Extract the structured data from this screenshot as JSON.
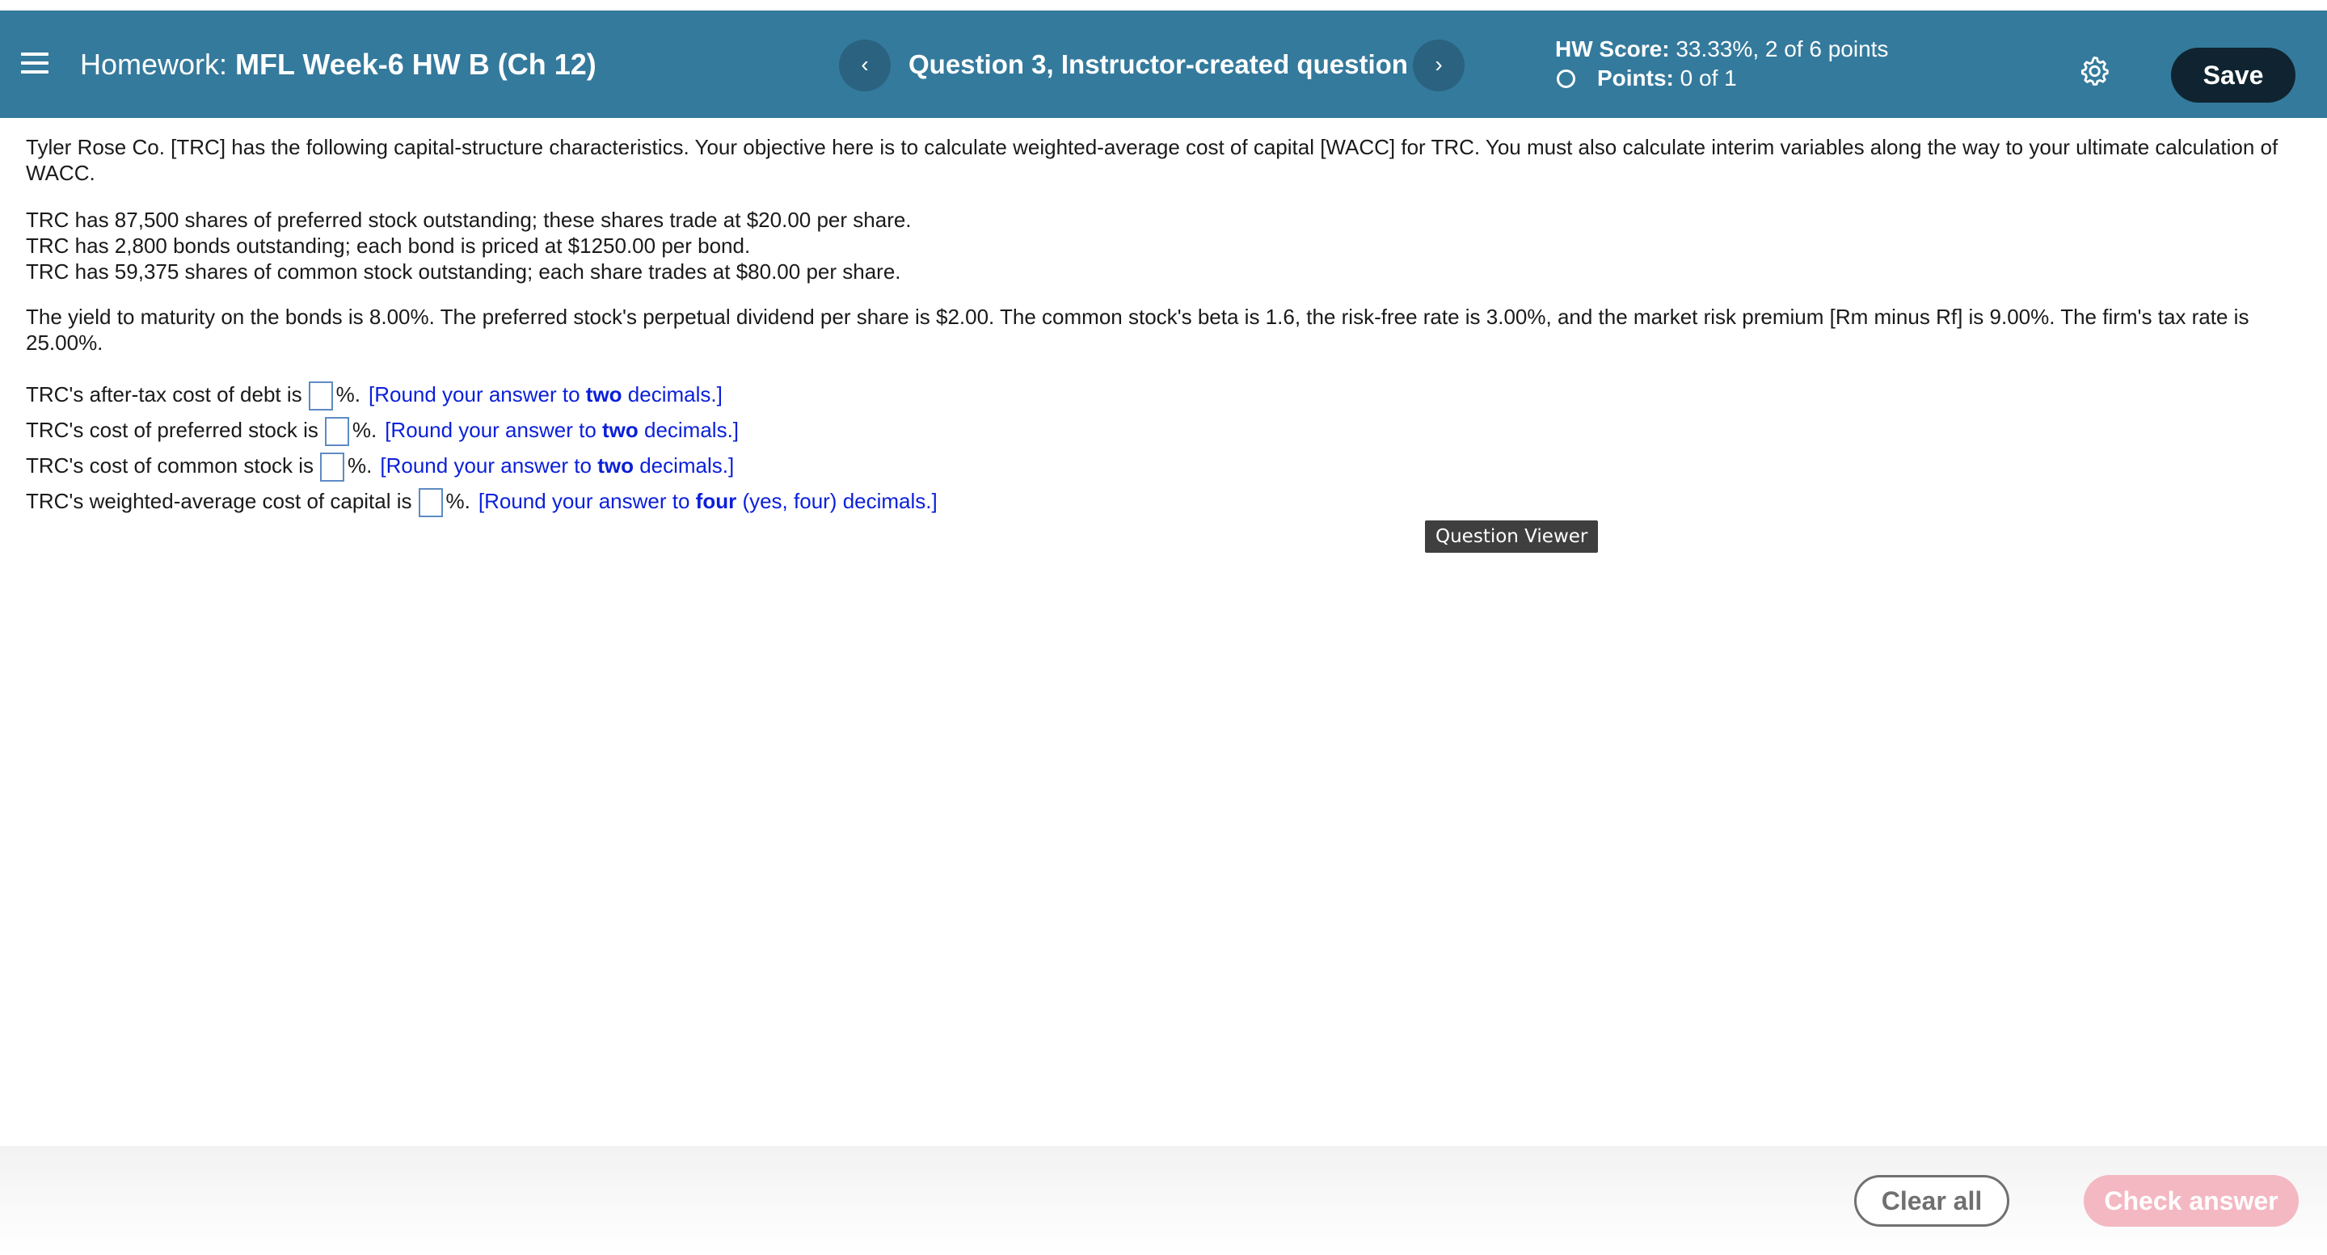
{
  "header": {
    "menu_icon": "hamburger-menu-icon",
    "homework_label": "Homework:",
    "homework_name": "MFL Week-6 HW B (Ch 12)",
    "prev_symbol": "‹",
    "next_symbol": "›",
    "question_title": "Question 3, Instructor-created question",
    "hw_score_label": "HW Score:",
    "hw_score_value": "33.33%, 2 of 6 points",
    "points_label": "Points:",
    "points_value": "0 of 1",
    "settings_icon": "gear-icon",
    "save_label": "Save",
    "colors": {
      "bar": "#347a9c",
      "save_button": "#0f2430"
    }
  },
  "question": {
    "intro": "Tyler Rose Co. [TRC] has the following capital-structure characteristics. Your objective here is to calculate weighted-average cost of capital [WACC] for TRC. You must also calculate interim variables along the way to your ultimate calculation of WACC.",
    "facts": [
      "TRC has 87,500 shares of preferred stock outstanding; these shares trade at $20.00 per share.",
      "TRC has 2,800 bonds outstanding; each bond is priced at $1250.00 per bond.",
      "TRC has 59,375 shares of common stock outstanding; each share trades at $80.00 per share."
    ],
    "details": "The yield to maturity on the bonds is 8.00%. The preferred stock's perpetual dividend per share is $2.00. The common stock's beta is 1.6, the risk-free rate is 3.00%, and the market risk premium [Rm minus Rf] is 9.00%. The firm's tax rate is 25.00%.",
    "items": [
      {
        "prompt": "TRC's after-tax cost of debt is",
        "value": "",
        "suffix": "%.",
        "hint_pre": "[Round your answer to ",
        "hint_bold": "two",
        "hint_post": " decimals.]"
      },
      {
        "prompt": "TRC's cost of preferred stock is",
        "value": "",
        "suffix": "%.",
        "hint_pre": "[Round your answer to ",
        "hint_bold": "two",
        "hint_post": " decimals.]"
      },
      {
        "prompt": "TRC's cost of common stock is",
        "value": "",
        "suffix": "%.",
        "hint_pre": "[Round your answer to ",
        "hint_bold": "two",
        "hint_post": " decimals.]"
      },
      {
        "prompt": "TRC's weighted-average cost of capital is",
        "value": "",
        "suffix": "%.",
        "hint_pre": "[Round your answer to ",
        "hint_bold": "four",
        "hint_post": " (yes, four) decimals.]"
      }
    ]
  },
  "tooltip": {
    "text": "Question Viewer"
  },
  "footer": {
    "clear_label": "Clear all",
    "check_label": "Check answer",
    "colors": {
      "check_button": "#f4b8c2"
    }
  }
}
